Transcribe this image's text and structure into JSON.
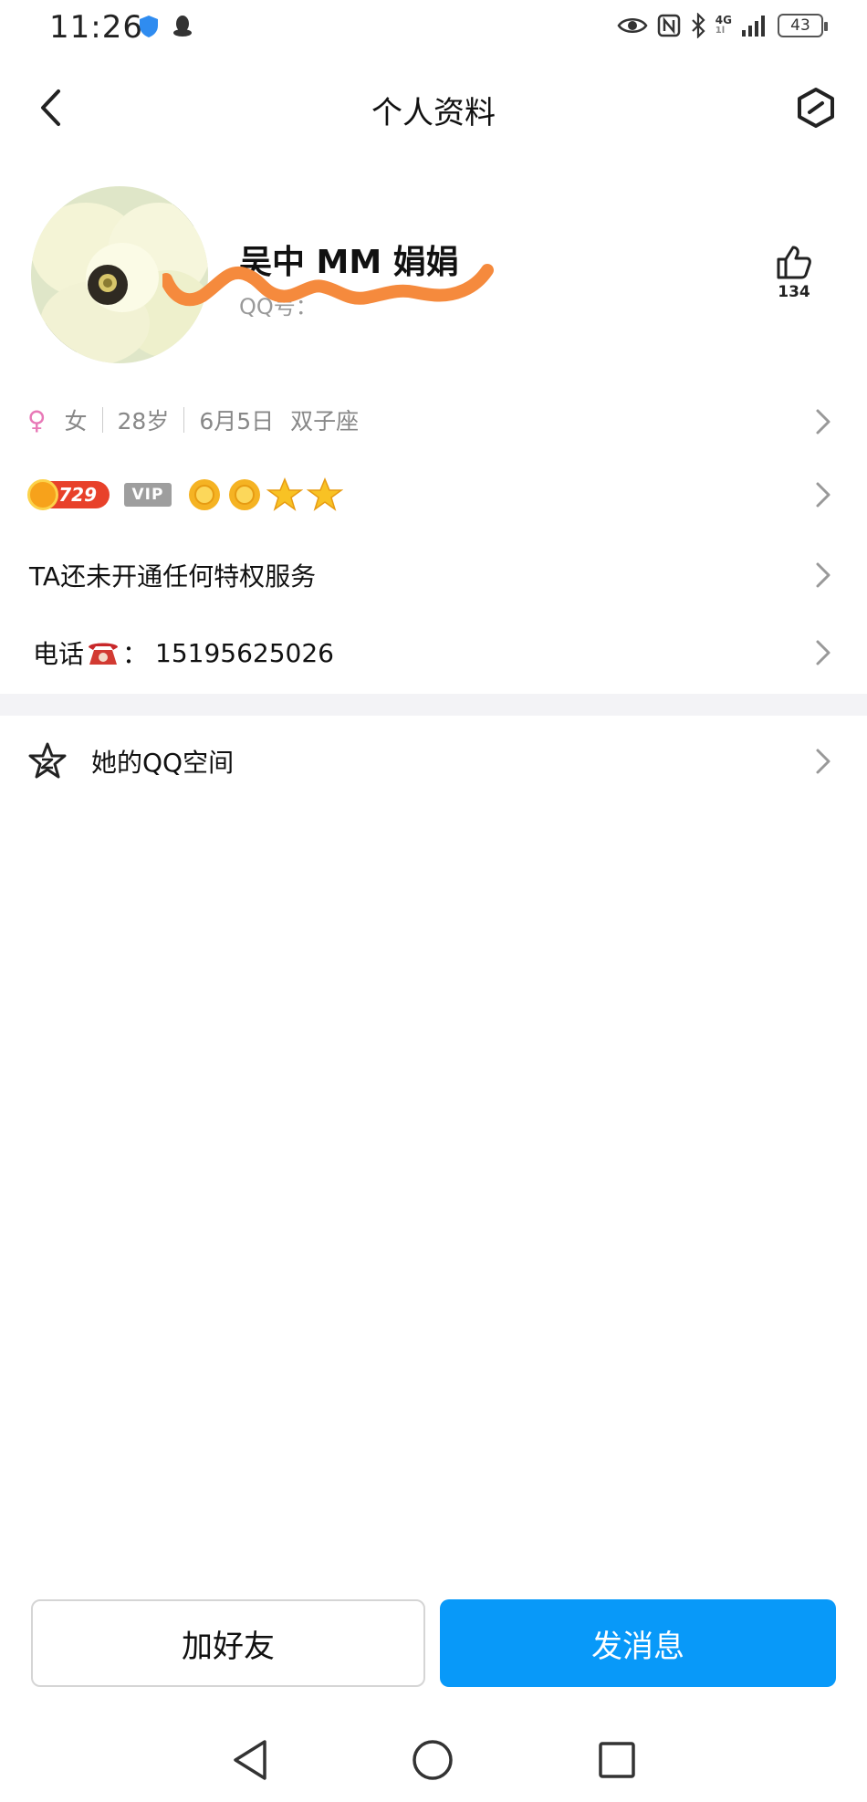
{
  "status_bar": {
    "time": "11:26",
    "network_label_top": "4G",
    "network_label_bottom": "1l",
    "battery": "43"
  },
  "header": {
    "title": "个人资料",
    "back_icon": "chevron-left-icon",
    "settings_icon": "hexagon-settings-icon"
  },
  "profile": {
    "nickname": "吴中 MM 娟娟",
    "qq_label": "QQ号：",
    "likes": "134",
    "avatar_desc": "flower-avatar"
  },
  "info": {
    "gender": "女",
    "age": "28岁",
    "birthday": "6月5日",
    "zodiac": "双子座"
  },
  "badges": {
    "level": "729",
    "vip": "VIP"
  },
  "privilege_text": "TA还未开通任何特权服务",
  "phone": {
    "label": "电话",
    "separator": "：",
    "number": "15195625026"
  },
  "zone": {
    "label": "她的QQ空间"
  },
  "actions": {
    "add_friend": "加好友",
    "send_message": "发消息"
  },
  "colors": {
    "accent": "#0899f9",
    "scribble": "#f58a3d",
    "female": "#e879b7"
  }
}
